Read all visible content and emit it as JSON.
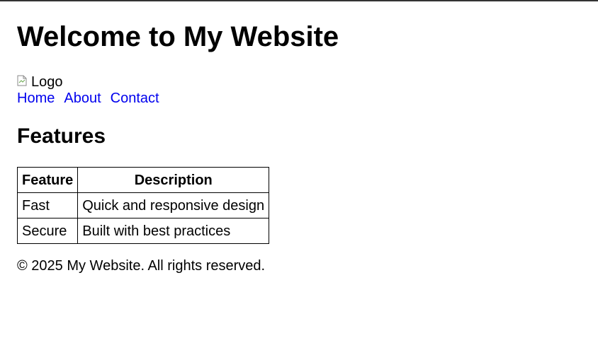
{
  "header": {
    "title": "Welcome to My Website"
  },
  "logo": {
    "alt": "Logo"
  },
  "nav": {
    "items": [
      {
        "label": "Home"
      },
      {
        "label": "About"
      },
      {
        "label": "Contact"
      }
    ]
  },
  "features": {
    "heading": "Features",
    "columns": [
      "Feature",
      "Description"
    ],
    "rows": [
      [
        "Fast",
        "Quick and responsive design"
      ],
      [
        "Secure",
        "Built with best practices"
      ]
    ]
  },
  "footer": {
    "text": "© 2025 My Website. All rights reserved."
  },
  "colors": {
    "link": "#0000ee",
    "text": "#000000"
  }
}
